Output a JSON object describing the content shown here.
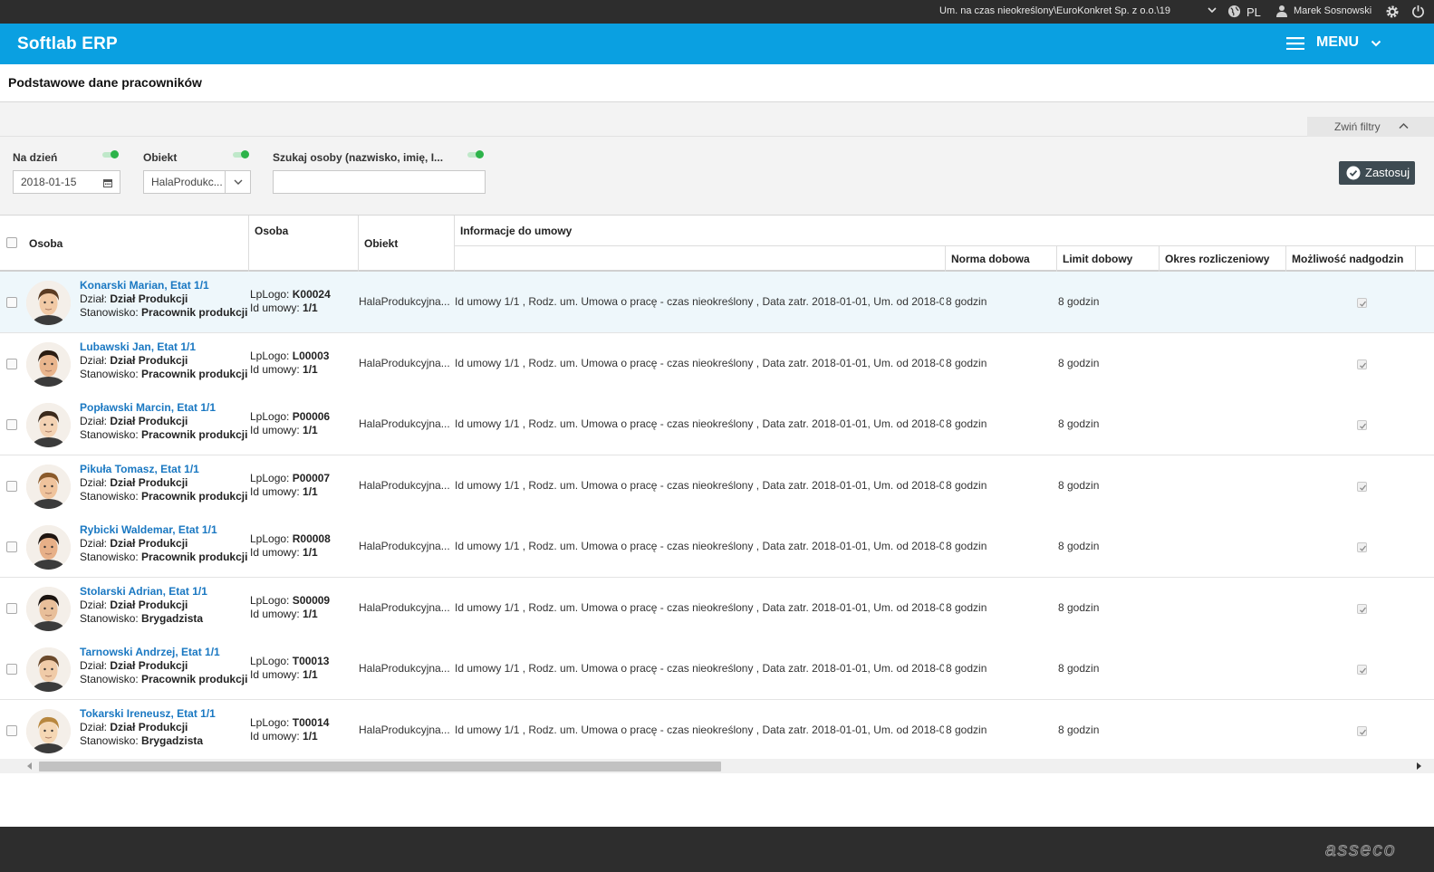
{
  "topbar": {
    "context": "Um. na czas nieokreślony\\EuroKonkret Sp. z o.o.\\19",
    "language": "PL",
    "user": "Marek Sosnowski"
  },
  "appbar": {
    "brand": "Softlab ERP",
    "menu_label": "MENU"
  },
  "page_title": "Podstawowe dane pracowników",
  "filters": {
    "collapse_label": "Zwiń filtry",
    "date_label": "Na dzień",
    "date_value": "2018-01-15",
    "object_label": "Obiekt",
    "object_value": "HalaProdukc...",
    "search_label": "Szukaj osoby (nazwisko, imię, I...",
    "search_value": "",
    "apply_label": "Zastosuj"
  },
  "grid": {
    "headers": {
      "osoba1": "Osoba",
      "osoba2": "Osoba",
      "obiekt": "Obiekt",
      "info": "Informacje do umowy",
      "norma": "Norma dobowa",
      "limit": "Limit dobowy",
      "okres": "Okres rozliczeniowy",
      "nadgodziny": "Możliwość nadgodzin"
    },
    "labels": {
      "dzial": "Dział:",
      "stanowisko": "Stanowisko:",
      "lplogo": "LpLogo:",
      "idumowy": "Id umowy:"
    },
    "rows": [
      {
        "name": "Konarski Marian, Etat 1/1",
        "dzial": "Dział Produkcji",
        "stanowisko": "Pracownik produkcji",
        "lplogo": "K00024",
        "idumowy": "1/1",
        "obiekt": "HalaProdukcyjna...",
        "info": "Id umowy 1/1 , Rodz. um. Umowa o pracę - czas nieokreślony , Data zatr. 2018-01-01, Um. od 2018-0...",
        "norma": "8 godzin",
        "limit": "8 godzin",
        "okres": "",
        "nadgodziny": true,
        "selected": true
      },
      {
        "name": "Lubawski Jan, Etat 1/1",
        "dzial": "Dział Produkcji",
        "stanowisko": "Pracownik produkcji",
        "lplogo": "L00003",
        "idumowy": "1/1",
        "obiekt": "HalaProdukcyjna...",
        "info": "Id umowy 1/1 , Rodz. um. Umowa o pracę - czas nieokreślony , Data zatr. 2018-01-01, Um. od 2018-0...",
        "norma": "8 godzin",
        "limit": "8 godzin",
        "okres": "",
        "nadgodziny": true,
        "selected": false
      },
      {
        "name": "Popławski Marcin, Etat 1/1",
        "dzial": "Dział Produkcji",
        "stanowisko": "Pracownik produkcji",
        "lplogo": "P00006",
        "idumowy": "1/1",
        "obiekt": "HalaProdukcyjna...",
        "info": "Id umowy 1/1 , Rodz. um. Umowa o pracę - czas nieokreślony , Data zatr. 2018-01-01, Um. od 2018-0...",
        "norma": "8 godzin",
        "limit": "8 godzin",
        "okres": "",
        "nadgodziny": true,
        "selected": false
      },
      {
        "name": "Pikuła Tomasz, Etat 1/1",
        "dzial": "Dział Produkcji",
        "stanowisko": "Pracownik produkcji",
        "lplogo": "P00007",
        "idumowy": "1/1",
        "obiekt": "HalaProdukcyjna...",
        "info": "Id umowy 1/1 , Rodz. um. Umowa o pracę - czas nieokreślony , Data zatr. 2018-01-01, Um. od 2018-0...",
        "norma": "8 godzin",
        "limit": "8 godzin",
        "okres": "",
        "nadgodziny": true,
        "selected": false
      },
      {
        "name": "Rybicki Waldemar, Etat 1/1",
        "dzial": "Dział Produkcji",
        "stanowisko": "Pracownik produkcji",
        "lplogo": "R00008",
        "idumowy": "1/1",
        "obiekt": "HalaProdukcyjna...",
        "info": "Id umowy 1/1 , Rodz. um. Umowa o pracę - czas nieokreślony , Data zatr. 2018-01-01, Um. od 2018-0...",
        "norma": "8 godzin",
        "limit": "8 godzin",
        "okres": "",
        "nadgodziny": true,
        "selected": false
      },
      {
        "name": "Stolarski Adrian, Etat 1/1",
        "dzial": "Dział Produkcji",
        "stanowisko": "Brygadzista",
        "lplogo": "S00009",
        "idumowy": "1/1",
        "obiekt": "HalaProdukcyjna...",
        "info": "Id umowy 1/1 , Rodz. um. Umowa o pracę - czas nieokreślony , Data zatr. 2018-01-01, Um. od 2018-0...",
        "norma": "8 godzin",
        "limit": "8 godzin",
        "okres": "",
        "nadgodziny": true,
        "selected": false
      },
      {
        "name": "Tarnowski Andrzej, Etat 1/1",
        "dzial": "Dział Produkcji",
        "stanowisko": "Pracownik produkcji",
        "lplogo": "T00013",
        "idumowy": "1/1",
        "obiekt": "HalaProdukcyjna...",
        "info": "Id umowy 1/1 , Rodz. um. Umowa o pracę - czas nieokreślony , Data zatr. 2018-01-01, Um. od 2018-0...",
        "norma": "8 godzin",
        "limit": "8 godzin",
        "okres": "",
        "nadgodziny": true,
        "selected": false
      },
      {
        "name": "Tokarski Ireneusz, Etat 1/1",
        "dzial": "Dział Produkcji",
        "stanowisko": "Brygadzista",
        "lplogo": "T00014",
        "idumowy": "1/1",
        "obiekt": "HalaProdukcyjna...",
        "info": "Id umowy 1/1 , Rodz. um. Umowa o pracę - czas nieokreślony , Data zatr. 2018-01-01, Um. od 2018-0...",
        "norma": "8 godzin",
        "limit": "8 godzin",
        "okres": "",
        "nadgodziny": true,
        "selected": false
      }
    ]
  },
  "footer": {
    "logo_text": "asseco"
  },
  "colors": {
    "topbar": "#2d2d2d",
    "appbar": "#0aa0e1",
    "link": "#1a78c2",
    "toggle_on": "#2db34a",
    "apply_button": "#3e4b52"
  },
  "icons": [
    "chevron-down-icon",
    "globe-icon",
    "user-icon",
    "gear-icon",
    "power-icon",
    "hamburger-icon",
    "calendar-icon",
    "chevron-up-icon",
    "check-circle-icon",
    "checkmark-icon",
    "arrow-left-icon",
    "arrow-right-icon"
  ]
}
